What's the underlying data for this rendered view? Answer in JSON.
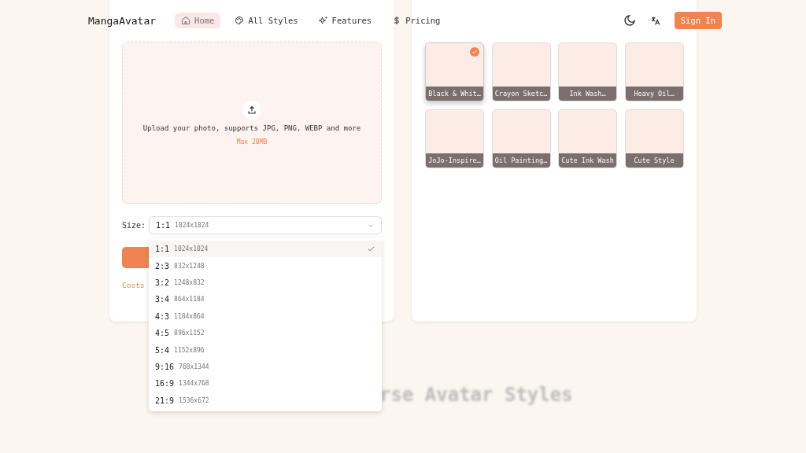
{
  "nav": {
    "logo": "MangaAvatar",
    "links": [
      {
        "label": "Home",
        "selected": true
      },
      {
        "label": "All Styles",
        "selected": false
      },
      {
        "label": "Features",
        "selected": false
      },
      {
        "label": "Pricing",
        "selected": false
      }
    ],
    "sign_in": "Sign In"
  },
  "upload": {
    "text": "Upload your photo, supports JPG, PNG, WEBP and more",
    "limit": "Max 20MB"
  },
  "size": {
    "label": "Size:",
    "ratio": "1:1",
    "dims": "1024x1024"
  },
  "options": [
    {
      "ratio": "1:1",
      "dims": "1024x1024",
      "selected": true
    },
    {
      "ratio": "2:3",
      "dims": "832x1248",
      "selected": false
    },
    {
      "ratio": "3:2",
      "dims": "1248x832",
      "selected": false
    },
    {
      "ratio": "3:4",
      "dims": "864x1184",
      "selected": false
    },
    {
      "ratio": "4:3",
      "dims": "1184x864",
      "selected": false
    },
    {
      "ratio": "4:5",
      "dims": "896x1152",
      "selected": false
    },
    {
      "ratio": "5:4",
      "dims": "1152x896",
      "selected": false
    },
    {
      "ratio": "9:16",
      "dims": "768x1344",
      "selected": false
    },
    {
      "ratio": "16:9",
      "dims": "1344x768",
      "selected": false
    },
    {
      "ratio": "21:9",
      "dims": "1536x672",
      "selected": false
    }
  ],
  "costs": "Costs",
  "styles": [
    {
      "label": "Black & Whit…",
      "selected": true
    },
    {
      "label": "Crayon Sketc…",
      "selected": false
    },
    {
      "label": "Ink Wash…",
      "selected": false
    },
    {
      "label": "Heavy Oil…",
      "selected": false
    },
    {
      "label": "JoJo-Inspire…",
      "selected": false
    },
    {
      "label": "Oil Painting…",
      "selected": false
    },
    {
      "label": "Cute Ink Wash",
      "selected": false
    },
    {
      "label": "Cute Style",
      "selected": false
    }
  ],
  "section_heading": "rse Avatar Styles"
}
